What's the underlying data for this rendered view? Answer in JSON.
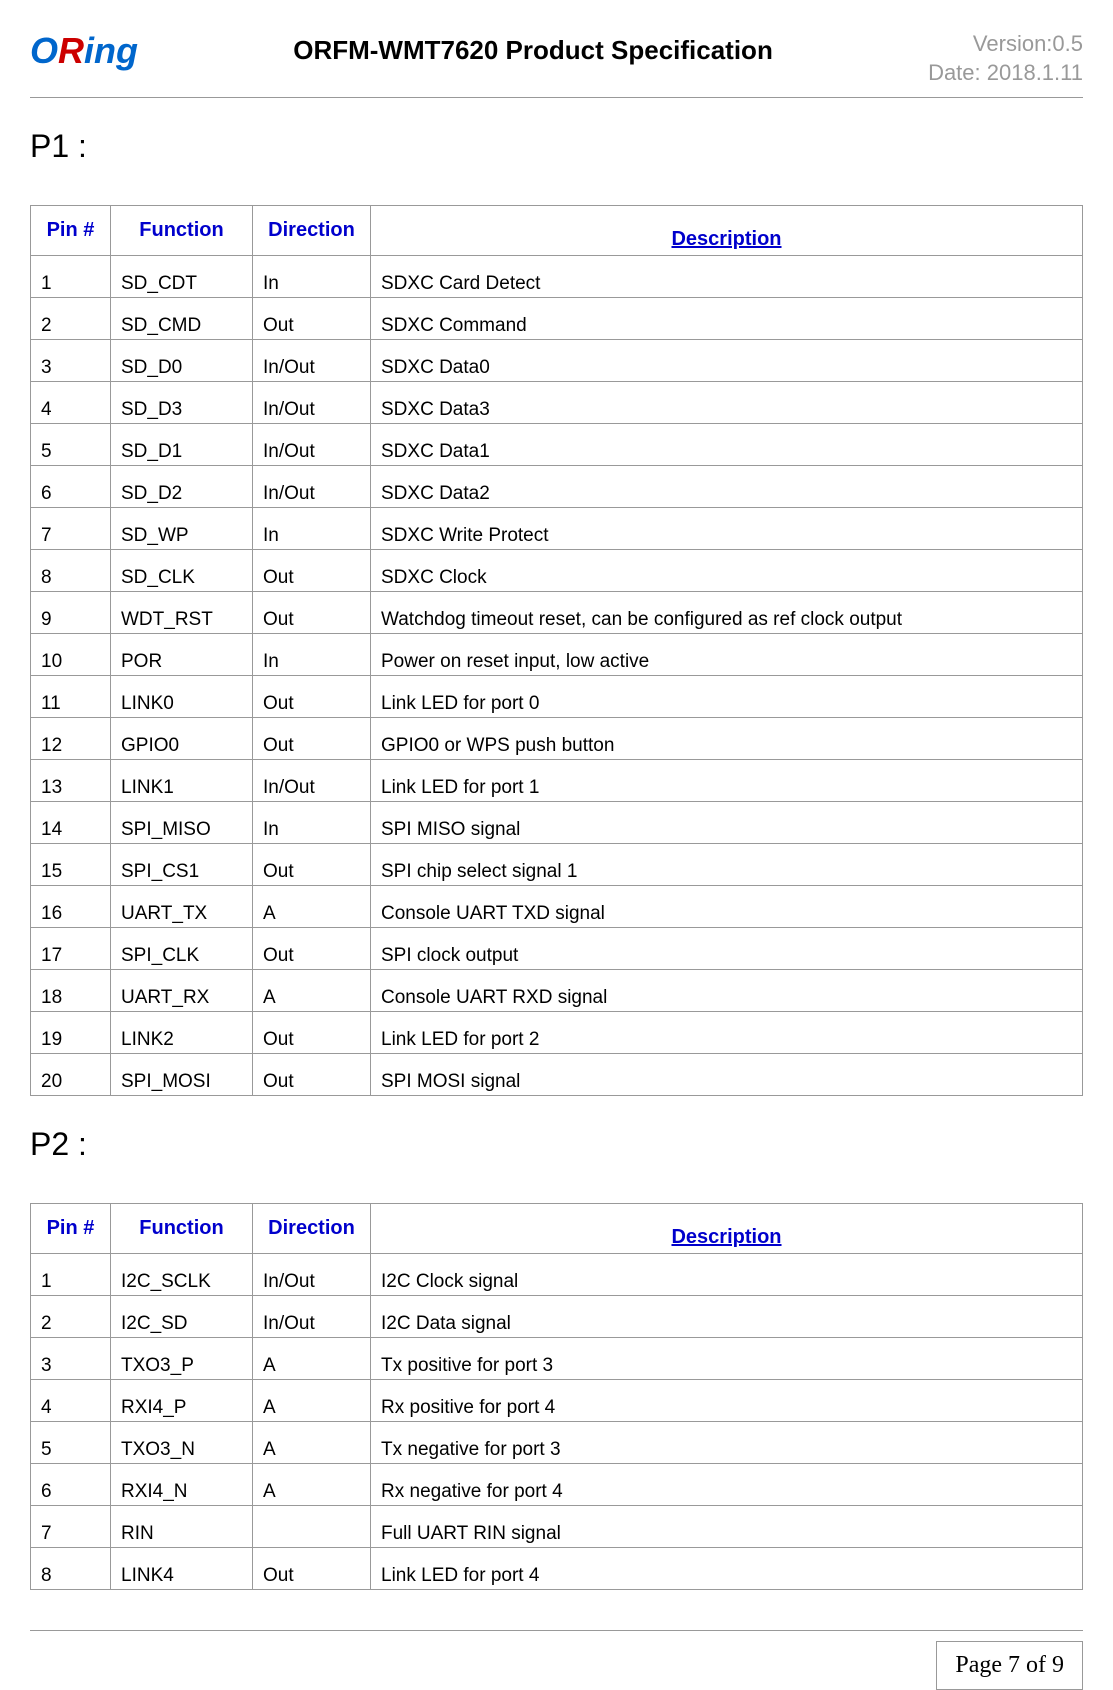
{
  "header": {
    "logo_text": "ORing",
    "title": "ORFM-WMT7620 Product Specification",
    "version": "Version:0.5",
    "date": "Date: 2018.1.11"
  },
  "sections": {
    "p1": {
      "heading": "P1 :",
      "headers": [
        "Pin #",
        "Function",
        "Direction",
        "Description"
      ],
      "rows": [
        {
          "pin": "1",
          "func": "SD_CDT",
          "dir": "In",
          "desc": "SDXC Card Detect"
        },
        {
          "pin": "2",
          "func": "SD_CMD",
          "dir": "Out",
          "desc": "SDXC Command"
        },
        {
          "pin": "3",
          "func": "SD_D0",
          "dir": "In/Out",
          "desc": "SDXC Data0"
        },
        {
          "pin": "4",
          "func": "SD_D3",
          "dir": "In/Out",
          "desc": "SDXC Data3"
        },
        {
          "pin": "5",
          "func": "SD_D1",
          "dir": "In/Out",
          "desc": "SDXC Data1"
        },
        {
          "pin": "6",
          "func": "SD_D2",
          "dir": "In/Out",
          "desc": "SDXC Data2"
        },
        {
          "pin": "7",
          "func": "SD_WP",
          "dir": "In",
          "desc": "SDXC Write Protect"
        },
        {
          "pin": "8",
          "func": "SD_CLK",
          "dir": "Out",
          "desc": "SDXC Clock"
        },
        {
          "pin": "9",
          "func": "WDT_RST",
          "dir": "Out",
          "desc": "Watchdog timeout reset, can be configured as ref clock output"
        },
        {
          "pin": "10",
          "func": "POR",
          "dir": "In",
          "desc": "Power on reset input, low active"
        },
        {
          "pin": "11",
          "func": "LINK0",
          "dir": "Out",
          "desc": "Link LED for port 0"
        },
        {
          "pin": "12",
          "func": "GPIO0",
          "dir": "Out",
          "desc": "GPIO0 or WPS push button"
        },
        {
          "pin": "13",
          "func": "LINK1",
          "dir": "In/Out",
          "desc": "Link LED for port 1"
        },
        {
          "pin": "14",
          "func": "SPI_MISO",
          "dir": "In",
          "desc": "SPI MISO signal"
        },
        {
          "pin": "15",
          "func": "SPI_CS1",
          "dir": "Out",
          "desc": "SPI chip select signal 1"
        },
        {
          "pin": "16",
          "func": "UART_TX",
          "dir": "A",
          "desc": "Console UART TXD signal"
        },
        {
          "pin": "17",
          "func": "SPI_CLK",
          "dir": "Out",
          "desc": "SPI clock output"
        },
        {
          "pin": "18",
          "func": "UART_RX",
          "dir": "A",
          "desc": "Console UART RXD signal"
        },
        {
          "pin": "19",
          "func": "LINK2",
          "dir": "Out",
          "desc": "Link LED for port 2"
        },
        {
          "pin": "20",
          "func": "SPI_MOSI",
          "dir": "Out",
          "desc": "SPI MOSI signal"
        }
      ]
    },
    "p2": {
      "heading": "P2 :",
      "headers": [
        "Pin #",
        "Function",
        "Direction",
        "Description"
      ],
      "rows": [
        {
          "pin": "1",
          "func": "I2C_SCLK",
          "dir": "In/Out",
          "desc": "I2C Clock signal"
        },
        {
          "pin": "2",
          "func": "I2C_SD",
          "dir": "In/Out",
          "desc": "I2C Data signal"
        },
        {
          "pin": "3",
          "func": "TXO3_P",
          "dir": "A",
          "desc": "Tx positive for port 3"
        },
        {
          "pin": "4",
          "func": "RXI4_P",
          "dir": "A",
          "desc": "Rx positive for port 4"
        },
        {
          "pin": "5",
          "func": "TXO3_N",
          "dir": "A",
          "desc": "Tx negative for port 3"
        },
        {
          "pin": "6",
          "func": "RXI4_N",
          "dir": "A",
          "desc": "Rx negative for port 4"
        },
        {
          "pin": "7",
          "func": "RIN",
          "dir": "",
          "desc": "Full UART RIN signal"
        },
        {
          "pin": "8",
          "func": "LINK4",
          "dir": "Out",
          "desc": "Link LED for port 4"
        }
      ]
    }
  },
  "footer": {
    "page": "Page 7 of 9"
  }
}
